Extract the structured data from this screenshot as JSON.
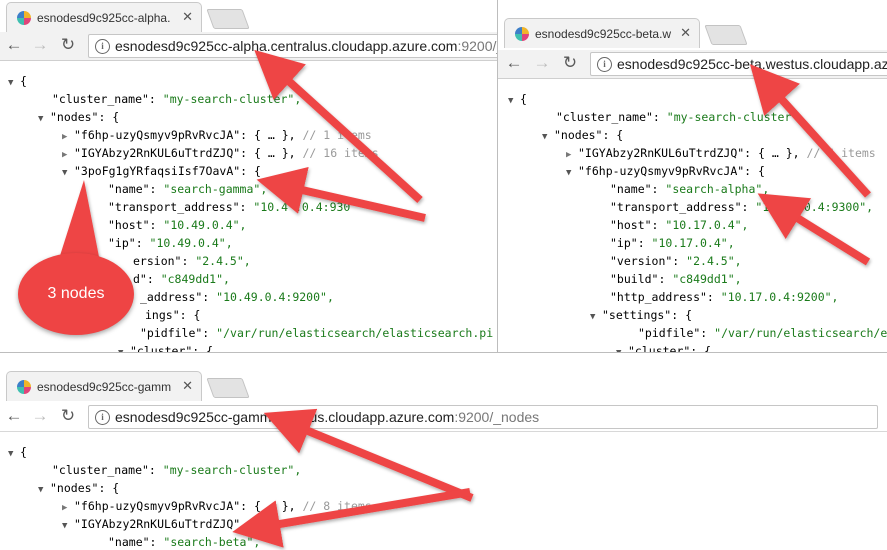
{
  "windows": {
    "alpha": {
      "tab_title": "esnodesd9c925cc-alpha.",
      "url_host": "esnodesd9c925cc-alpha.centralus.cloudapp.azure.com",
      "url_path": ":9200/_"
    },
    "beta": {
      "tab_title": "esnodesd9c925cc-beta.w",
      "url_host": "esnodesd9c925cc-beta.westus.cloudapp.azure.",
      "url_path": ""
    },
    "gamma": {
      "tab_title": "esnodesd9c925cc-gamm",
      "url_host": "esnodesd9c925cc-gamma.eastus.cloudapp.azure.com",
      "url_path": ":9200/_nodes"
    }
  },
  "json_view": {
    "open_brace": "{",
    "cluster_name_key": "\"cluster_name\": ",
    "cluster_name_value": "\"my-search-cluster\",",
    "cluster_name_value_beta": "\"my-search-cluster\"",
    "nodes_key": "\"nodes\": {",
    "node_f6hp": "\"f6hp-uzyQsmyv9pRvRvcJA\": ",
    "node_igya": "\"IGYAbzy2RnKUL6uTtrdZJQ\": ",
    "node_3pof": "\"3poFg1gYRfaqsiIsf7OavA\": {",
    "node_f6hp_open": "\"f6hp-uzyQsmyv9pRvRvcJA\": {",
    "node_igya_open": "\"IGYAbzy2RnKUL6uTtrdZJQ\"",
    "collapsed": "{ … },",
    "collapsed_beta": "{ … },",
    "comment_16": "// 16 items",
    "comment_1": "// 1 items",
    "comment_6": "// 6 items",
    "comment_8": "// 8 items",
    "name_key": "\"name\": ",
    "gamma_name": "\"search-gamma\",",
    "alpha_name": "\"search-alpha\",",
    "beta_name": "\"search-beta\",",
    "transport_key": "\"transport_address\": ",
    "gamma_transport": "\"10.4 .0.4:930",
    "alpha_transport": "\"10.1 .0.4:9300\",",
    "host_key": "\"host\": ",
    "gamma_host": "\"10.49.0.4\",",
    "alpha_host": "\"10.17.0.4\",",
    "ip_key": "\"ip\": ",
    "gamma_ip": "\"10.49.0.4\",",
    "alpha_ip": "\"10.17.0.4\",",
    "version_key": "\"version\": ",
    "version_key_partial": "ersion\": ",
    "version_value": "\"2.4.5\",",
    "build_key": "\"build\": ",
    "build_key_partial": "d\": ",
    "build_value": "\"c849dd1\",",
    "http_key": "\"http_address\": ",
    "http_key_partial": "_address\": ",
    "gamma_http": "\"10.49.0.4:9200\",",
    "alpha_http": "\"10.17.0.4:9200\",",
    "settings_key": "\"settings\": {",
    "settings_key_partial": "ings\": {",
    "pidfile_key": "\"pidfile\": ",
    "pidfile_gamma": "\"/var/run/elasticsearch/elasticsearch.pi",
    "pidfile_alpha": "\"/var/run/elasticsearch/e",
    "cluster_key": "\"cluster\": {",
    "cluster_key_beta": "\"cluster\": {"
  },
  "callout": {
    "label": "3 nodes"
  },
  "colors": {
    "arrow": "#ee4444",
    "string": "#1a7a1a",
    "comment": "#9a9a9a"
  }
}
